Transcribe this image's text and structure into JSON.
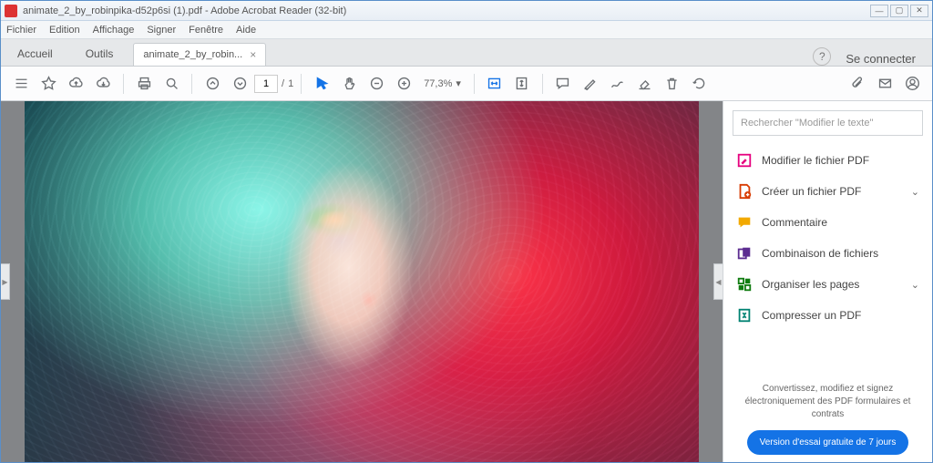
{
  "window": {
    "title": "animate_2_by_robinpika-d52p6si (1).pdf - Adobe Acrobat Reader (32-bit)"
  },
  "menu": {
    "file": "Fichier",
    "edit": "Edition",
    "view": "Affichage",
    "sign": "Signer",
    "window": "Fenêtre",
    "help": "Aide"
  },
  "tabs": {
    "home": "Accueil",
    "tools": "Outils",
    "doc": "animate_2_by_robin...",
    "signin": "Se connecter"
  },
  "toolbar": {
    "page_current": "1",
    "page_sep": "/",
    "page_total": "1",
    "zoom": "77,3%"
  },
  "search": {
    "placeholder": "Rechercher \"Modifier le texte\""
  },
  "tools": [
    {
      "label": "Modifier le fichier PDF",
      "color": "#e6007e",
      "chev": false
    },
    {
      "label": "Créer un fichier PDF",
      "color": "#d83b01",
      "chev": true
    },
    {
      "label": "Commentaire",
      "color": "#f2a900",
      "chev": false
    },
    {
      "label": "Combinaison de fichiers",
      "color": "#5c2d91",
      "chev": false
    },
    {
      "label": "Organiser les pages",
      "color": "#107c10",
      "chev": true
    },
    {
      "label": "Compresser un PDF",
      "color": "#008272",
      "chev": false
    }
  ],
  "promo": {
    "text": "Convertissez, modifiez et signez électroniquement des PDF formulaires et contrats",
    "button": "Version d'essai gratuite de 7 jours"
  }
}
